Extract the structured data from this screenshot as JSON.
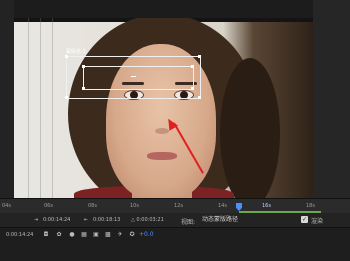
{
  "viewer": {
    "mask_label": "蒙版名-1"
  },
  "ruler": {
    "labels": [
      "04s",
      "06s",
      "08s",
      "10s",
      "12s",
      "14s",
      "16s",
      "18s"
    ],
    "active_label": "16s"
  },
  "controls": {
    "current_time": "0:00:14:24",
    "in_point": "0:00:18:13",
    "duration": "△ 0:00:03:21",
    "view_label": "视图:",
    "view_value": "动态蒙版路径",
    "render_label": "渲染",
    "render_checked": true
  },
  "toolbar": {
    "timecode": "0:00:14:24",
    "exposure": "+0.0"
  },
  "colors": {
    "annotation_arrow": "#e02020",
    "mask_stroke": "#f0f0f0",
    "accent_blue": "#4a8fff",
    "work_area_green": "#6aa84f"
  }
}
